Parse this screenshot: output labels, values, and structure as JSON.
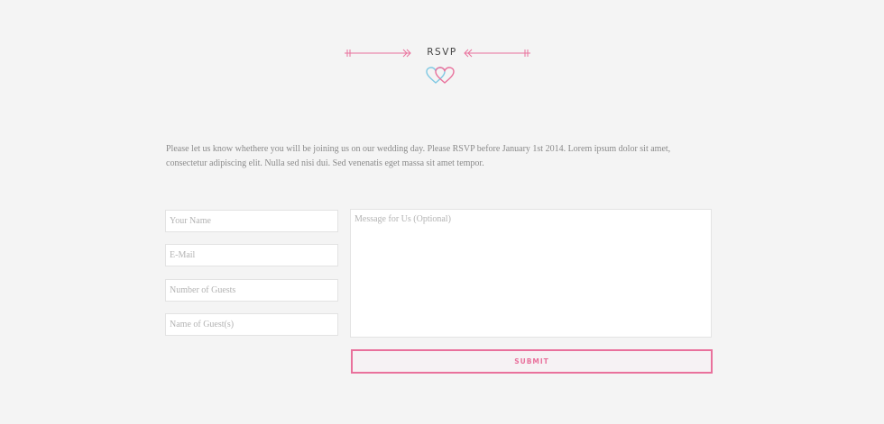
{
  "section": {
    "title": "RSVP"
  },
  "intro": {
    "text": "Please let us know whethere you will be joining us on our wedding day. Please RSVP before January 1st 2014. Lorem ipsum dolor sit amet, consectetur adipiscing elit. Nulla sed nisi dui. Sed venenatis eget massa sit amet tempor."
  },
  "form": {
    "name_placeholder": "Your Name",
    "email_placeholder": "E-Mail",
    "guests_placeholder": "Number of Guests",
    "guest_names_placeholder": "Name of Guest(s)",
    "message_placeholder": "Message for Us (Optional)",
    "submit_label": "SUBMIT"
  },
  "icons": {
    "left_arrow": "arrow-right-icon",
    "right_arrow": "arrow-left-icon",
    "hearts": "interlocked-hearts-icon"
  },
  "colors": {
    "accent_pink": "#e9719c",
    "accent_blue": "#7ec8e3",
    "background": "#f4f4f4"
  }
}
